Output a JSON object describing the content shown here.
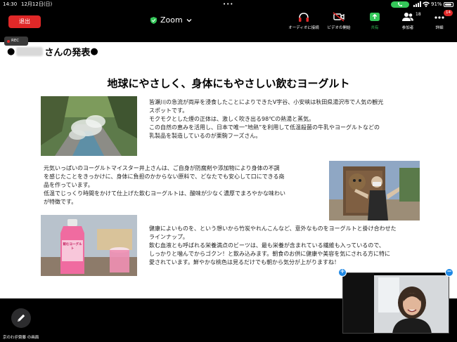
{
  "status_bar": {
    "time": "14:30",
    "date": "12月12日(日)",
    "battery_pct": "91%",
    "battery_level": 0.91
  },
  "toolbar": {
    "leave_label": "退出",
    "app_title": "Zoom",
    "audio_label": "オーディオに接続",
    "video_label": "ビデオの開始",
    "share_label": "共有",
    "participants_label": "参加者",
    "participants_count": "18",
    "more_label": "詳細",
    "more_badge": "14"
  },
  "recording": {
    "label": "REC"
  },
  "slide": {
    "presenter_suffix": "さんの発表",
    "bullet": "●",
    "title": "地球にやさしく、身体にもやさしい飲むヨーグルト",
    "para1": [
      "皆瀬川の急流が両岸を浸食したことによりできたV字谷、小安峡は秋田県湯沢市で人気の観光",
      "スポットです。",
      "モクモクとした煙の正体は、激しく吹き出る98℃の熱湯と蒸気。",
      "この自然の恵みを活用し、日本で唯一“地熱”を利用して低温殺菌の牛乳やヨーグルトなどの",
      "乳製品を製造しているのが栗駒フーズさん。"
    ],
    "para2": [
      "元気いっぱいのヨーグルトマイスター井上さんは、ご自身が防腐剤や添加物により身体の不調",
      "を感じたことをきっかけに、身体に負担のかからない原料で、どなたでも安心して口にできる商",
      "品を作っています。",
      "低温でじっくり時間をかけて仕上げた飲むヨーグルトは、酸味が少なく濃厚でまろやかな味わい",
      "が特徴です。"
    ],
    "para3": [
      "健康によいものを、という想いから竹炭やれんこんなど、意外なものをヨーグルトと掛け合わせた",
      "ラインナップ。",
      "飲む血液とも呼ばれる栄養満点のビーツは、最も栄養が含まれている繊維も入っているので、",
      "しっかりと噛んでからゴクン！と飲み込みます。朝食のお供に健康や美容を気にされる方に特に",
      "愛されています。鮮やかな桃色は見るだけでも朝から気分が上がりますね！"
    ],
    "bottle_label": "飲むヨーグルト"
  },
  "thumbnail": {
    "minus_symbol": "−",
    "plus_symbol": "+"
  },
  "footer": {
    "screen_label": "京のわ＠齋藤 の画面"
  },
  "colors": {
    "leave": "#e02828",
    "share_green": "#34c759",
    "badge_red": "#e02828",
    "thumb_button": "#1e88e5"
  }
}
